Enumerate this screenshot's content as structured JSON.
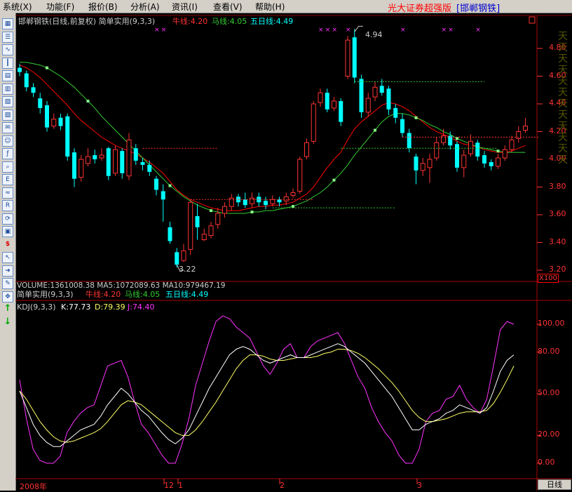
{
  "menu": {
    "items": [
      "系统(X)",
      "功能(F)",
      "报价(B)",
      "分析(A)",
      "资讯(I)",
      "查看(V)",
      "帮助(H)"
    ],
    "brand": "光大证券超强版",
    "stock_tag": "[邯郸钢铁]"
  },
  "toolbar": {
    "icons": [
      "grid-icon",
      "list-icon",
      "line-chart-icon",
      "candles-icon",
      "table-icon",
      "panel-icon",
      "report-icon",
      "doc-icon",
      "mail-icon",
      "people-icon",
      "fw-icon",
      "zoom-icon",
      "eit-icon",
      "wave-icon",
      "rsi-icon",
      "sync-icon",
      "cols-icon",
      "dollar-icon",
      "pointer-icon",
      "import-icon",
      "pen-icon",
      "move-icon",
      "arrow-up-icon",
      "arrow-down-icon"
    ]
  },
  "price_panel": {
    "title": "邯郸钢铁(日线,前复权) 简单实用(9,3,3)",
    "niu_label": "牛线:4.20",
    "ma_label": "马线:4.05",
    "five_label": "五日线:4.49",
    "high_annot": "4.94",
    "low_annot": "3.22",
    "ticks": [
      "4.80",
      "4.60",
      "4.40",
      "4.20",
      "4.00",
      "3.80",
      "3.60",
      "3.40",
      "3.20"
    ],
    "side_text": "天天天天天天天天天天天天",
    "x100": "X100"
  },
  "volume_line": "VOLUME:1361008.38  MA5:1072089.63  MA10:979467.19",
  "kdj_panel": {
    "title2": "简单实用(9,3,3)",
    "niu_label": "牛线:4.20",
    "ma_label": "马线:4.05",
    "five_label": "五日线:4.49",
    "title": "KDJ(9,3,3)",
    "k_label": "K:77.73",
    "d_label": "D:79.39",
    "j_label": "J:74.40",
    "ticks": [
      "100.00",
      "80.00",
      "50.00",
      "20.00",
      "0.00"
    ]
  },
  "xaxis": {
    "labels": [
      "2008年",
      "12",
      "1",
      "2",
      "3"
    ]
  },
  "period_button": "日线",
  "colors": {
    "up": "#ff3333",
    "down": "#00ffff",
    "ma_red": "#ff0000",
    "ma_green": "#33cc33",
    "k_white": "#ffffff",
    "d_yellow": "#ffff66",
    "j_magenta": "#ff33ff",
    "brand_red": "#ff0000"
  },
  "chart_data": {
    "type": "candlestick",
    "candles": [
      {
        "o": 4.66,
        "c": 4.63,
        "h": 4.69,
        "l": 4.6
      },
      {
        "o": 4.62,
        "c": 4.52,
        "h": 4.64,
        "l": 4.49
      },
      {
        "o": 4.52,
        "c": 4.48,
        "h": 4.55,
        "l": 4.45
      },
      {
        "o": 4.44,
        "c": 4.37,
        "h": 4.48,
        "l": 4.33
      },
      {
        "o": 4.39,
        "c": 4.23,
        "h": 4.42,
        "l": 4.2
      },
      {
        "o": 4.24,
        "c": 4.29,
        "h": 4.33,
        "l": 4.22
      },
      {
        "o": 4.3,
        "c": 4.24,
        "h": 4.33,
        "l": 4.21
      },
      {
        "o": 4.31,
        "c": 4.02,
        "h": 4.33,
        "l": 3.99
      },
      {
        "o": 4.05,
        "c": 3.86,
        "h": 4.08,
        "l": 3.8
      },
      {
        "o": 3.87,
        "c": 4.0,
        "h": 4.03,
        "l": 3.84
      },
      {
        "o": 3.97,
        "c": 4.02,
        "h": 4.08,
        "l": 3.95
      },
      {
        "o": 4.03,
        "c": 4.0,
        "h": 4.07,
        "l": 3.97
      },
      {
        "o": 4.01,
        "c": 4.03,
        "h": 4.08,
        "l": 3.99
      },
      {
        "o": 4.08,
        "c": 3.88,
        "h": 4.09,
        "l": 3.85
      },
      {
        "o": 3.9,
        "c": 4.07,
        "h": 4.1,
        "l": 3.88
      },
      {
        "o": 4.06,
        "c": 3.9,
        "h": 4.08,
        "l": 3.86
      },
      {
        "o": 3.88,
        "c": 4.14,
        "h": 4.19,
        "l": 3.85
      },
      {
        "o": 4.08,
        "c": 3.99,
        "h": 4.11,
        "l": 3.96
      },
      {
        "o": 3.98,
        "c": 3.96,
        "h": 4.01,
        "l": 3.92
      },
      {
        "o": 3.96,
        "c": 3.91,
        "h": 3.99,
        "l": 3.88
      },
      {
        "o": 3.86,
        "c": 3.78,
        "h": 3.88,
        "l": 3.74
      },
      {
        "o": 3.77,
        "c": 3.71,
        "h": 3.82,
        "l": 3.55
      },
      {
        "o": 3.51,
        "c": 3.41,
        "h": 3.55,
        "l": 3.39
      },
      {
        "o": 3.33,
        "c": 3.24,
        "h": 3.36,
        "l": 3.22
      },
      {
        "o": 3.27,
        "c": 3.34,
        "h": 3.39,
        "l": 3.26
      },
      {
        "o": 3.35,
        "c": 3.69,
        "h": 3.71,
        "l": 3.31
      },
      {
        "o": 3.59,
        "c": 3.51,
        "h": 3.68,
        "l": 3.42
      },
      {
        "o": 3.42,
        "c": 3.46,
        "h": 3.5,
        "l": 3.41
      },
      {
        "o": 3.45,
        "c": 3.52,
        "h": 3.55,
        "l": 3.43
      },
      {
        "o": 3.53,
        "c": 3.61,
        "h": 3.65,
        "l": 3.5
      },
      {
        "o": 3.61,
        "c": 3.66,
        "h": 3.69,
        "l": 3.58
      },
      {
        "o": 3.66,
        "c": 3.72,
        "h": 3.75,
        "l": 3.63
      },
      {
        "o": 3.73,
        "c": 3.69,
        "h": 3.75,
        "l": 3.66
      },
      {
        "o": 3.71,
        "c": 3.67,
        "h": 3.76,
        "l": 3.65
      },
      {
        "o": 3.68,
        "c": 3.72,
        "h": 3.76,
        "l": 3.65
      },
      {
        "o": 3.73,
        "c": 3.69,
        "h": 3.76,
        "l": 3.66
      },
      {
        "o": 3.7,
        "c": 3.67,
        "h": 3.73,
        "l": 3.64
      },
      {
        "o": 3.68,
        "c": 3.71,
        "h": 3.74,
        "l": 3.66
      },
      {
        "o": 3.71,
        "c": 3.69,
        "h": 3.73,
        "l": 3.66
      },
      {
        "o": 3.7,
        "c": 3.73,
        "h": 3.76,
        "l": 3.67
      },
      {
        "o": 3.74,
        "c": 3.76,
        "h": 3.79,
        "l": 3.72
      },
      {
        "o": 3.77,
        "c": 4.0,
        "h": 4.02,
        "l": 3.75
      },
      {
        "o": 4.02,
        "c": 4.12,
        "h": 4.15,
        "l": 4.0
      },
      {
        "o": 4.13,
        "c": 4.4,
        "h": 4.42,
        "l": 4.11
      },
      {
        "o": 4.41,
        "c": 4.48,
        "h": 4.51,
        "l": 4.38
      },
      {
        "o": 4.48,
        "c": 4.36,
        "h": 4.51,
        "l": 4.34
      },
      {
        "o": 4.37,
        "c": 4.42,
        "h": 4.45,
        "l": 4.35
      },
      {
        "o": 4.42,
        "c": 4.27,
        "h": 4.44,
        "l": 4.24
      },
      {
        "o": 4.6,
        "c": 4.86,
        "h": 4.89,
        "l": 4.58
      },
      {
        "o": 4.88,
        "c": 4.59,
        "h": 4.94,
        "l": 4.55
      },
      {
        "o": 4.58,
        "c": 4.34,
        "h": 4.61,
        "l": 4.3
      },
      {
        "o": 4.34,
        "c": 4.44,
        "h": 4.48,
        "l": 4.31
      },
      {
        "o": 4.45,
        "c": 4.52,
        "h": 4.56,
        "l": 4.42
      },
      {
        "o": 4.53,
        "c": 4.48,
        "h": 4.58,
        "l": 4.46
      },
      {
        "o": 4.51,
        "c": 4.36,
        "h": 4.53,
        "l": 4.32
      },
      {
        "o": 4.37,
        "c": 4.3,
        "h": 4.4,
        "l": 4.26
      },
      {
        "o": 4.29,
        "c": 4.19,
        "h": 4.33,
        "l": 4.16
      },
      {
        "o": 4.19,
        "c": 4.08,
        "h": 4.22,
        "l": 4.05
      },
      {
        "o": 4.02,
        "c": 3.92,
        "h": 4.04,
        "l": 3.82
      },
      {
        "o": 3.92,
        "c": 3.97,
        "h": 4.01,
        "l": 3.88
      },
      {
        "o": 3.94,
        "c": 4.0,
        "h": 4.04,
        "l": 3.83
      },
      {
        "o": 4.01,
        "c": 4.12,
        "h": 4.16,
        "l": 3.99
      },
      {
        "o": 4.12,
        "c": 4.17,
        "h": 4.22,
        "l": 4.1
      },
      {
        "o": 4.17,
        "c": 4.1,
        "h": 4.2,
        "l": 4.07
      },
      {
        "o": 4.11,
        "c": 3.94,
        "h": 4.13,
        "l": 3.91
      },
      {
        "o": 3.94,
        "c": 4.03,
        "h": 4.07,
        "l": 3.87
      },
      {
        "o": 4.04,
        "c": 4.13,
        "h": 4.18,
        "l": 4.02
      },
      {
        "o": 4.12,
        "c": 4.02,
        "h": 4.14,
        "l": 3.99
      },
      {
        "o": 4.03,
        "c": 3.97,
        "h": 4.06,
        "l": 3.94
      },
      {
        "o": 3.98,
        "c": 3.95,
        "h": 4.0,
        "l": 3.92
      },
      {
        "o": 3.95,
        "c": 4.01,
        "h": 4.04,
        "l": 3.93
      },
      {
        "o": 4.01,
        "c": 4.07,
        "h": 4.1,
        "l": 3.99
      },
      {
        "o": 4.07,
        "c": 4.14,
        "h": 4.17,
        "l": 4.05
      },
      {
        "o": 4.15,
        "c": 4.2,
        "h": 4.24,
        "l": 4.12
      },
      {
        "o": 4.21,
        "c": 4.24,
        "h": 4.3,
        "l": 4.19
      }
    ],
    "ma_red": [
      4.68,
      4.66,
      4.63,
      4.59,
      4.54,
      4.49,
      4.44,
      4.39,
      4.33,
      4.28,
      4.24,
      4.2,
      4.16,
      4.13,
      4.1,
      4.08,
      4.06,
      4.04,
      4.01,
      3.98,
      3.94,
      3.9,
      3.84,
      3.78,
      3.74,
      3.71,
      3.69,
      3.67,
      3.65,
      3.64,
      3.63,
      3.63,
      3.63,
      3.64,
      3.65,
      3.66,
      3.66,
      3.67,
      3.67,
      3.68,
      3.69,
      3.72,
      3.75,
      3.8,
      3.87,
      3.94,
      4.0,
      4.05,
      4.14,
      4.22,
      4.27,
      4.31,
      4.35,
      4.39,
      4.41,
      4.4,
      4.38,
      4.35,
      4.31,
      4.27,
      4.23,
      4.2,
      4.18,
      4.16,
      4.13,
      4.11,
      4.1,
      4.09,
      4.07,
      4.06,
      4.05,
      4.05,
      4.06,
      4.08,
      4.1
    ],
    "ma_green": [
      4.7,
      4.7,
      4.69,
      4.68,
      4.66,
      4.63,
      4.6,
      4.56,
      4.52,
      4.47,
      4.42,
      4.37,
      4.31,
      4.26,
      4.21,
      4.16,
      4.11,
      4.06,
      4.01,
      3.96,
      3.91,
      3.86,
      3.81,
      3.77,
      3.73,
      3.7,
      3.67,
      3.65,
      3.63,
      3.62,
      3.61,
      3.61,
      3.61,
      3.61,
      3.62,
      3.62,
      3.63,
      3.63,
      3.64,
      3.65,
      3.66,
      3.68,
      3.7,
      3.73,
      3.76,
      3.8,
      3.85,
      3.9,
      3.96,
      4.03,
      4.09,
      4.15,
      4.21,
      4.27,
      4.31,
      4.33,
      4.33,
      4.32,
      4.3,
      4.28,
      4.25,
      4.23,
      4.2,
      4.18,
      4.15,
      4.13,
      4.11,
      4.09,
      4.08,
      4.07,
      4.06,
      4.05,
      4.05,
      4.05,
      4.05
    ],
    "kdj_k": [
      52,
      40,
      28,
      20,
      15,
      12,
      12,
      16,
      20,
      24,
      26,
      28,
      34,
      42,
      48,
      54,
      50,
      44,
      38,
      34,
      28,
      22,
      17,
      14,
      18,
      24,
      34,
      44,
      54,
      62,
      70,
      78,
      82,
      84,
      82,
      78,
      74,
      72,
      74,
      76,
      78,
      76,
      76,
      78,
      80,
      82,
      84,
      86,
      84,
      80,
      76,
      72,
      66,
      60,
      54,
      48,
      40,
      32,
      24,
      24,
      28,
      30,
      32,
      36,
      38,
      42,
      40,
      38,
      36,
      40,
      52,
      66,
      74,
      78
    ],
    "kdj_d": [
      52,
      46,
      38,
      30,
      24,
      19,
      16,
      15,
      16,
      18,
      20,
      22,
      25,
      30,
      36,
      42,
      45,
      44,
      42,
      38,
      34,
      30,
      26,
      22,
      20,
      20,
      24,
      30,
      37,
      44,
      52,
      60,
      68,
      74,
      78,
      78,
      77,
      75,
      74,
      74,
      75,
      76,
      76,
      76,
      77,
      79,
      80,
      82,
      82,
      81,
      79,
      76,
      72,
      68,
      63,
      58,
      52,
      45,
      38,
      33,
      30,
      30,
      31,
      32,
      34,
      36,
      37,
      37,
      37,
      38,
      43,
      51,
      60,
      70
    ],
    "kdj_j": [
      60,
      32,
      10,
      2,
      0,
      0,
      5,
      22,
      30,
      36,
      40,
      42,
      56,
      70,
      72,
      74,
      62,
      44,
      28,
      22,
      14,
      6,
      0,
      0,
      14,
      32,
      56,
      72,
      88,
      102,
      106,
      104,
      98,
      94,
      90,
      80,
      70,
      64,
      72,
      82,
      86,
      76,
      76,
      84,
      88,
      90,
      92,
      94,
      86,
      74,
      62,
      54,
      40,
      30,
      22,
      16,
      6,
      0,
      0,
      10,
      30,
      36,
      38,
      46,
      48,
      56,
      46,
      40,
      36,
      46,
      70,
      96,
      102,
      100
    ]
  }
}
